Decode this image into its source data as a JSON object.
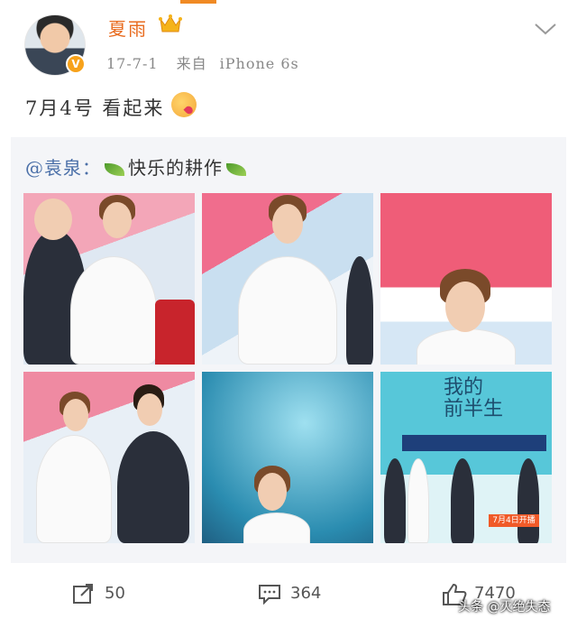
{
  "header": {
    "username": "夏雨",
    "date": "17-7-1",
    "source_prefix": "来自",
    "source": "iPhone 6s",
    "verified_icon": "verified-v-icon"
  },
  "post": {
    "text": "7月4号 看起来"
  },
  "repost": {
    "mention": "@袁泉",
    "separator": "：",
    "text": "快乐的耕作",
    "images": [
      {
        "alt_name": "photo-1"
      },
      {
        "alt_name": "photo-2"
      },
      {
        "alt_name": "photo-3"
      },
      {
        "alt_name": "photo-4"
      },
      {
        "alt_name": "photo-5"
      },
      {
        "alt_name": "photo-6"
      }
    ],
    "poster_title_line1": "我的",
    "poster_title_line2": "前半生",
    "poster_date": "7月4日开播"
  },
  "actions": {
    "repost_count": "50",
    "comment_count": "364",
    "like_count": "7470"
  },
  "watermark": "头条 @灭绝失态",
  "colors": {
    "accent": "#f08a24",
    "username": "#e86b1f",
    "link": "#4a6fa8",
    "repost_bg": "#f4f5f8"
  }
}
